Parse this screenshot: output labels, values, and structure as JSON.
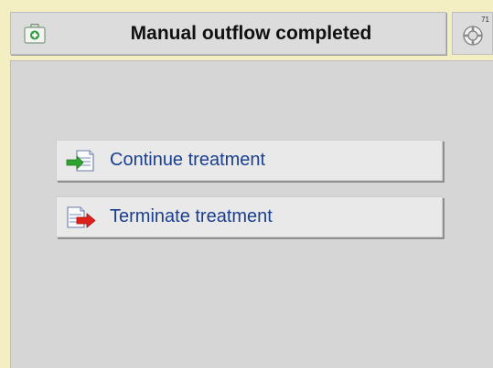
{
  "header": {
    "title": "Manual outflow completed",
    "left_icon": "first-aid-kit-icon",
    "right_icon": "lifebuoy-icon",
    "counter": "71"
  },
  "options": [
    {
      "label": "Continue treatment",
      "icon": "continue-arrow-icon",
      "icon_color": "#2fa32f"
    },
    {
      "label": "Terminate treatment",
      "icon": "terminate-arrow-icon",
      "icon_color": "#e0201b"
    }
  ],
  "colors": {
    "background": "#f3efc3",
    "panel": "#dcdcdc",
    "content": "#d6d6d6",
    "button": "#e9e9e9",
    "label_text": "#1b3f8f"
  }
}
